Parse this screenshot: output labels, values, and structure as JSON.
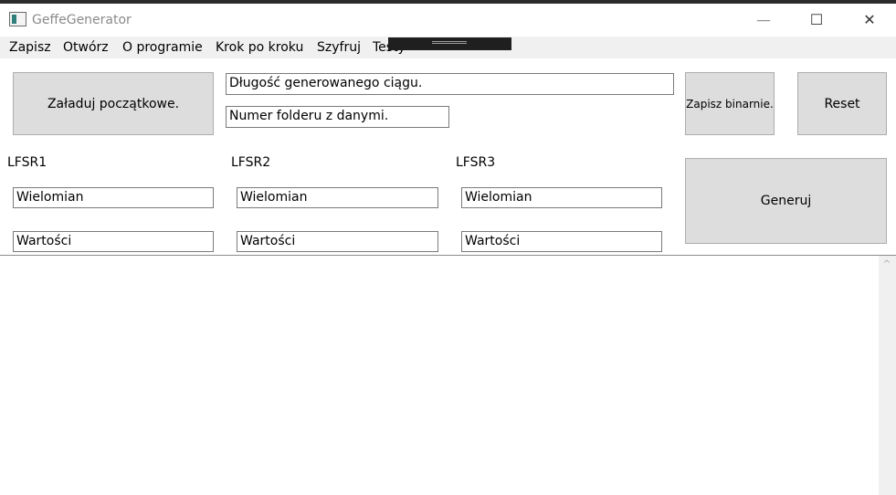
{
  "window": {
    "title": "GeffeGenerator",
    "controls": {
      "minimize": "—",
      "maximize": "☐",
      "close": "✕"
    }
  },
  "menu": {
    "items": [
      "Zapisz",
      "Otwórz",
      "O programie",
      "Krok po kroku",
      "Szyfruj",
      "Testy"
    ]
  },
  "top": {
    "load_button": "Załaduj początkowe.",
    "length_field": "Długość generowanego ciągu.",
    "folder_field": "Numer folderu z danymi.",
    "save_binary_button": "Zapisz binarnie.",
    "reset_button": "Reset",
    "generate_button": "Generuj"
  },
  "lfsr": [
    {
      "label": "LFSR1",
      "polynomial": "Wielomian",
      "values": "Wartości"
    },
    {
      "label": "LFSR2",
      "polynomial": "Wielomian",
      "values": "Wartości"
    },
    {
      "label": "LFSR3",
      "polynomial": "Wielomian",
      "values": "Wartości"
    }
  ],
  "scrollbar": {
    "up_arrow": "^"
  }
}
